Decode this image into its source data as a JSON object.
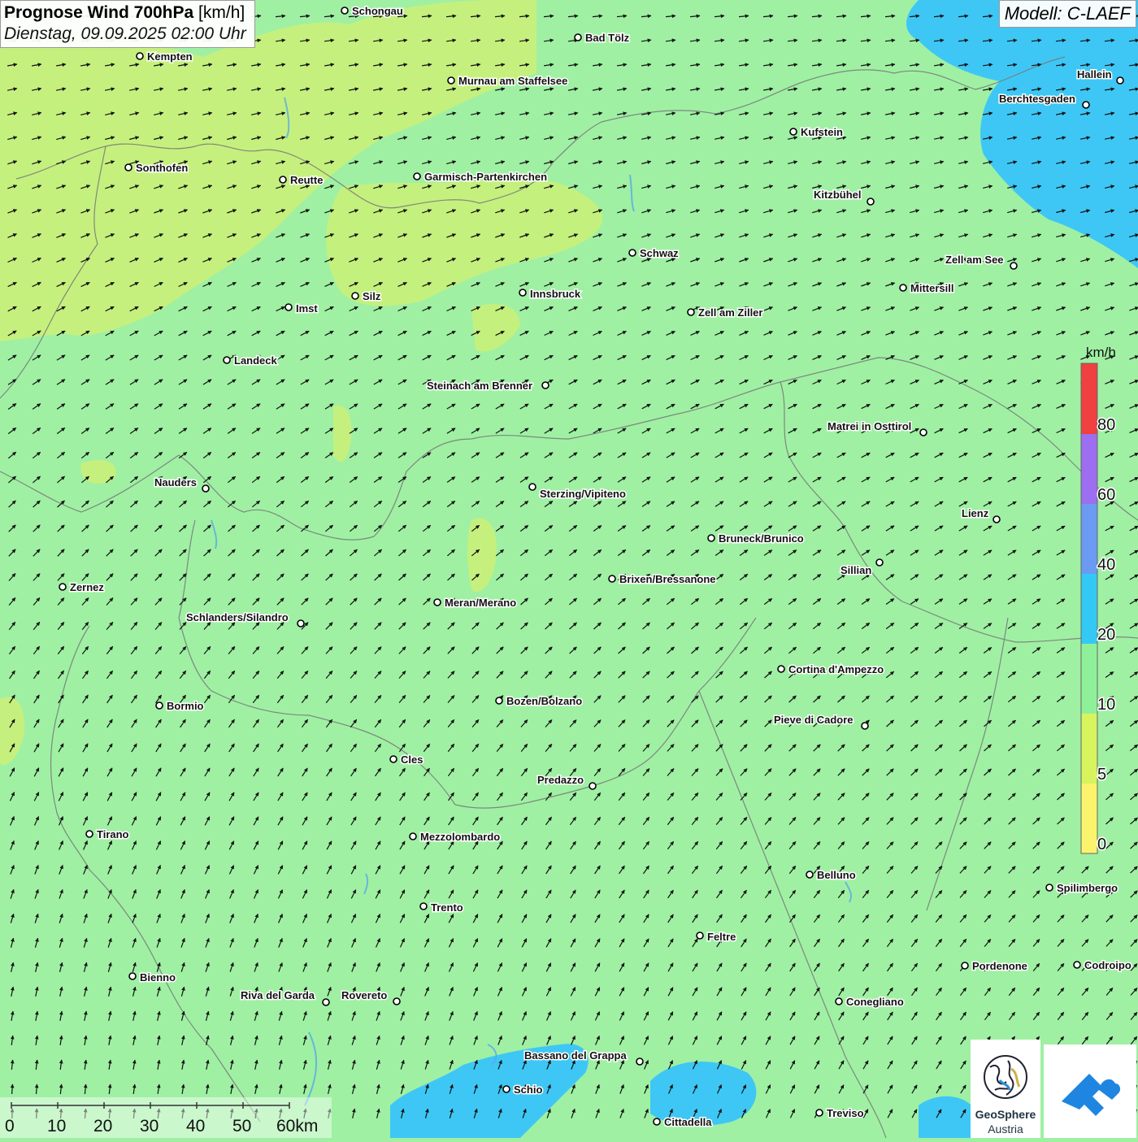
{
  "header": {
    "title_bold": "Prognose Wind 700hPa",
    "title_unit": "[km/h]",
    "datetime": "Dienstag, 09.09.2025 02:00 Uhr",
    "model": "Modell: C-LAEF"
  },
  "legend": {
    "unit": "km/h",
    "ticks": [
      "0",
      "5",
      "10",
      "20",
      "40",
      "60",
      "80"
    ],
    "colors": [
      "#fbf36b",
      "#d7f45f",
      "#8ff09a",
      "#33c9f4",
      "#6b9af3",
      "#9d6ef0",
      "#f04040"
    ]
  },
  "scalebar": {
    "labels": [
      "0",
      "10",
      "20",
      "30",
      "40",
      "50",
      "60km"
    ]
  },
  "cities": [
    {
      "name": "Schongau"
    },
    {
      "name": "Bad Tölz"
    },
    {
      "name": "Kempten"
    },
    {
      "name": "Murnau am Staffelsee"
    },
    {
      "name": "Hallein"
    },
    {
      "name": "Berchtesgaden"
    },
    {
      "name": "Kufstein"
    },
    {
      "name": "Sonthofen"
    },
    {
      "name": "Reutte"
    },
    {
      "name": "Garmisch-Partenkirchen"
    },
    {
      "name": "Kitzbühel"
    },
    {
      "name": "Schwaz"
    },
    {
      "name": "Zell am See"
    },
    {
      "name": "Mittersill"
    },
    {
      "name": "Innsbruck"
    },
    {
      "name": "Silz"
    },
    {
      "name": "Imst"
    },
    {
      "name": "Zell am Ziller"
    },
    {
      "name": "Landeck"
    },
    {
      "name": "Steinach am Brenner"
    },
    {
      "name": "Matrei in Osttirol"
    },
    {
      "name": "Nauders"
    },
    {
      "name": "Sterzing/Vipiteno"
    },
    {
      "name": "Lienz"
    },
    {
      "name": "Bruneck/Brunico"
    },
    {
      "name": "Sillian"
    },
    {
      "name": "Brixen/Bressanone"
    },
    {
      "name": "Zernez"
    },
    {
      "name": "Meran/Merano"
    },
    {
      "name": "Schlanders/Silandro"
    },
    {
      "name": "Cortina d'Ampezzo"
    },
    {
      "name": "Bozen/Bolzano"
    },
    {
      "name": "Bormio"
    },
    {
      "name": "Pieve di Cadore"
    },
    {
      "name": "Cles"
    },
    {
      "name": "Predazzo"
    },
    {
      "name": "Tirano"
    },
    {
      "name": "Mezzolombardo"
    },
    {
      "name": "Belluno"
    },
    {
      "name": "Spilimbergo"
    },
    {
      "name": "Trento"
    },
    {
      "name": "Feltre"
    },
    {
      "name": "Pordenone"
    },
    {
      "name": "Codroipo"
    },
    {
      "name": "Bienno"
    },
    {
      "name": "Riva del Garda"
    },
    {
      "name": "Rovereto"
    },
    {
      "name": "Conegliano"
    },
    {
      "name": "Bassano del Grappa"
    },
    {
      "name": "Schio"
    },
    {
      "name": "Treviso"
    },
    {
      "name": "Cittadella"
    }
  ],
  "logo": {
    "line1": "GeoSphere",
    "line2": "Austria"
  }
}
